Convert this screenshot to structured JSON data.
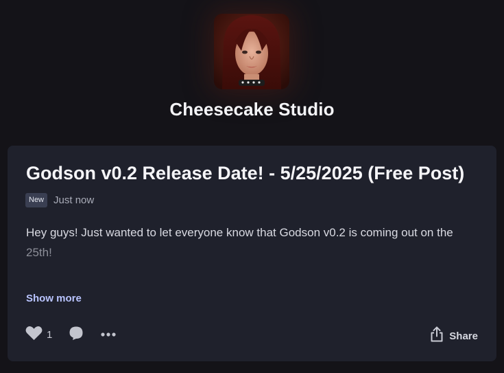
{
  "creator": {
    "name": "Cheesecake Studio",
    "avatar_icon": "creator-avatar"
  },
  "post": {
    "title": "Godson v0.2 Release Date! - 5/25/2025 (Free Post)",
    "badge": "New",
    "timestamp": "Just now",
    "body_line1": "Hey guys! Just wanted to let everyone know that Godson v0.2 is coming out on the",
    "body_line2": "25th!",
    "show_more_label": "Show more"
  },
  "actions": {
    "like_count": "1",
    "like_icon": "heart-icon",
    "comment_icon": "comment-icon",
    "more_icon": "more-options-icon",
    "share_icon": "share-icon",
    "share_label": "Share"
  },
  "colors": {
    "background": "#141318",
    "card": "#1f212c",
    "link": "#b9c4ff",
    "badge": "#3a3f52"
  }
}
